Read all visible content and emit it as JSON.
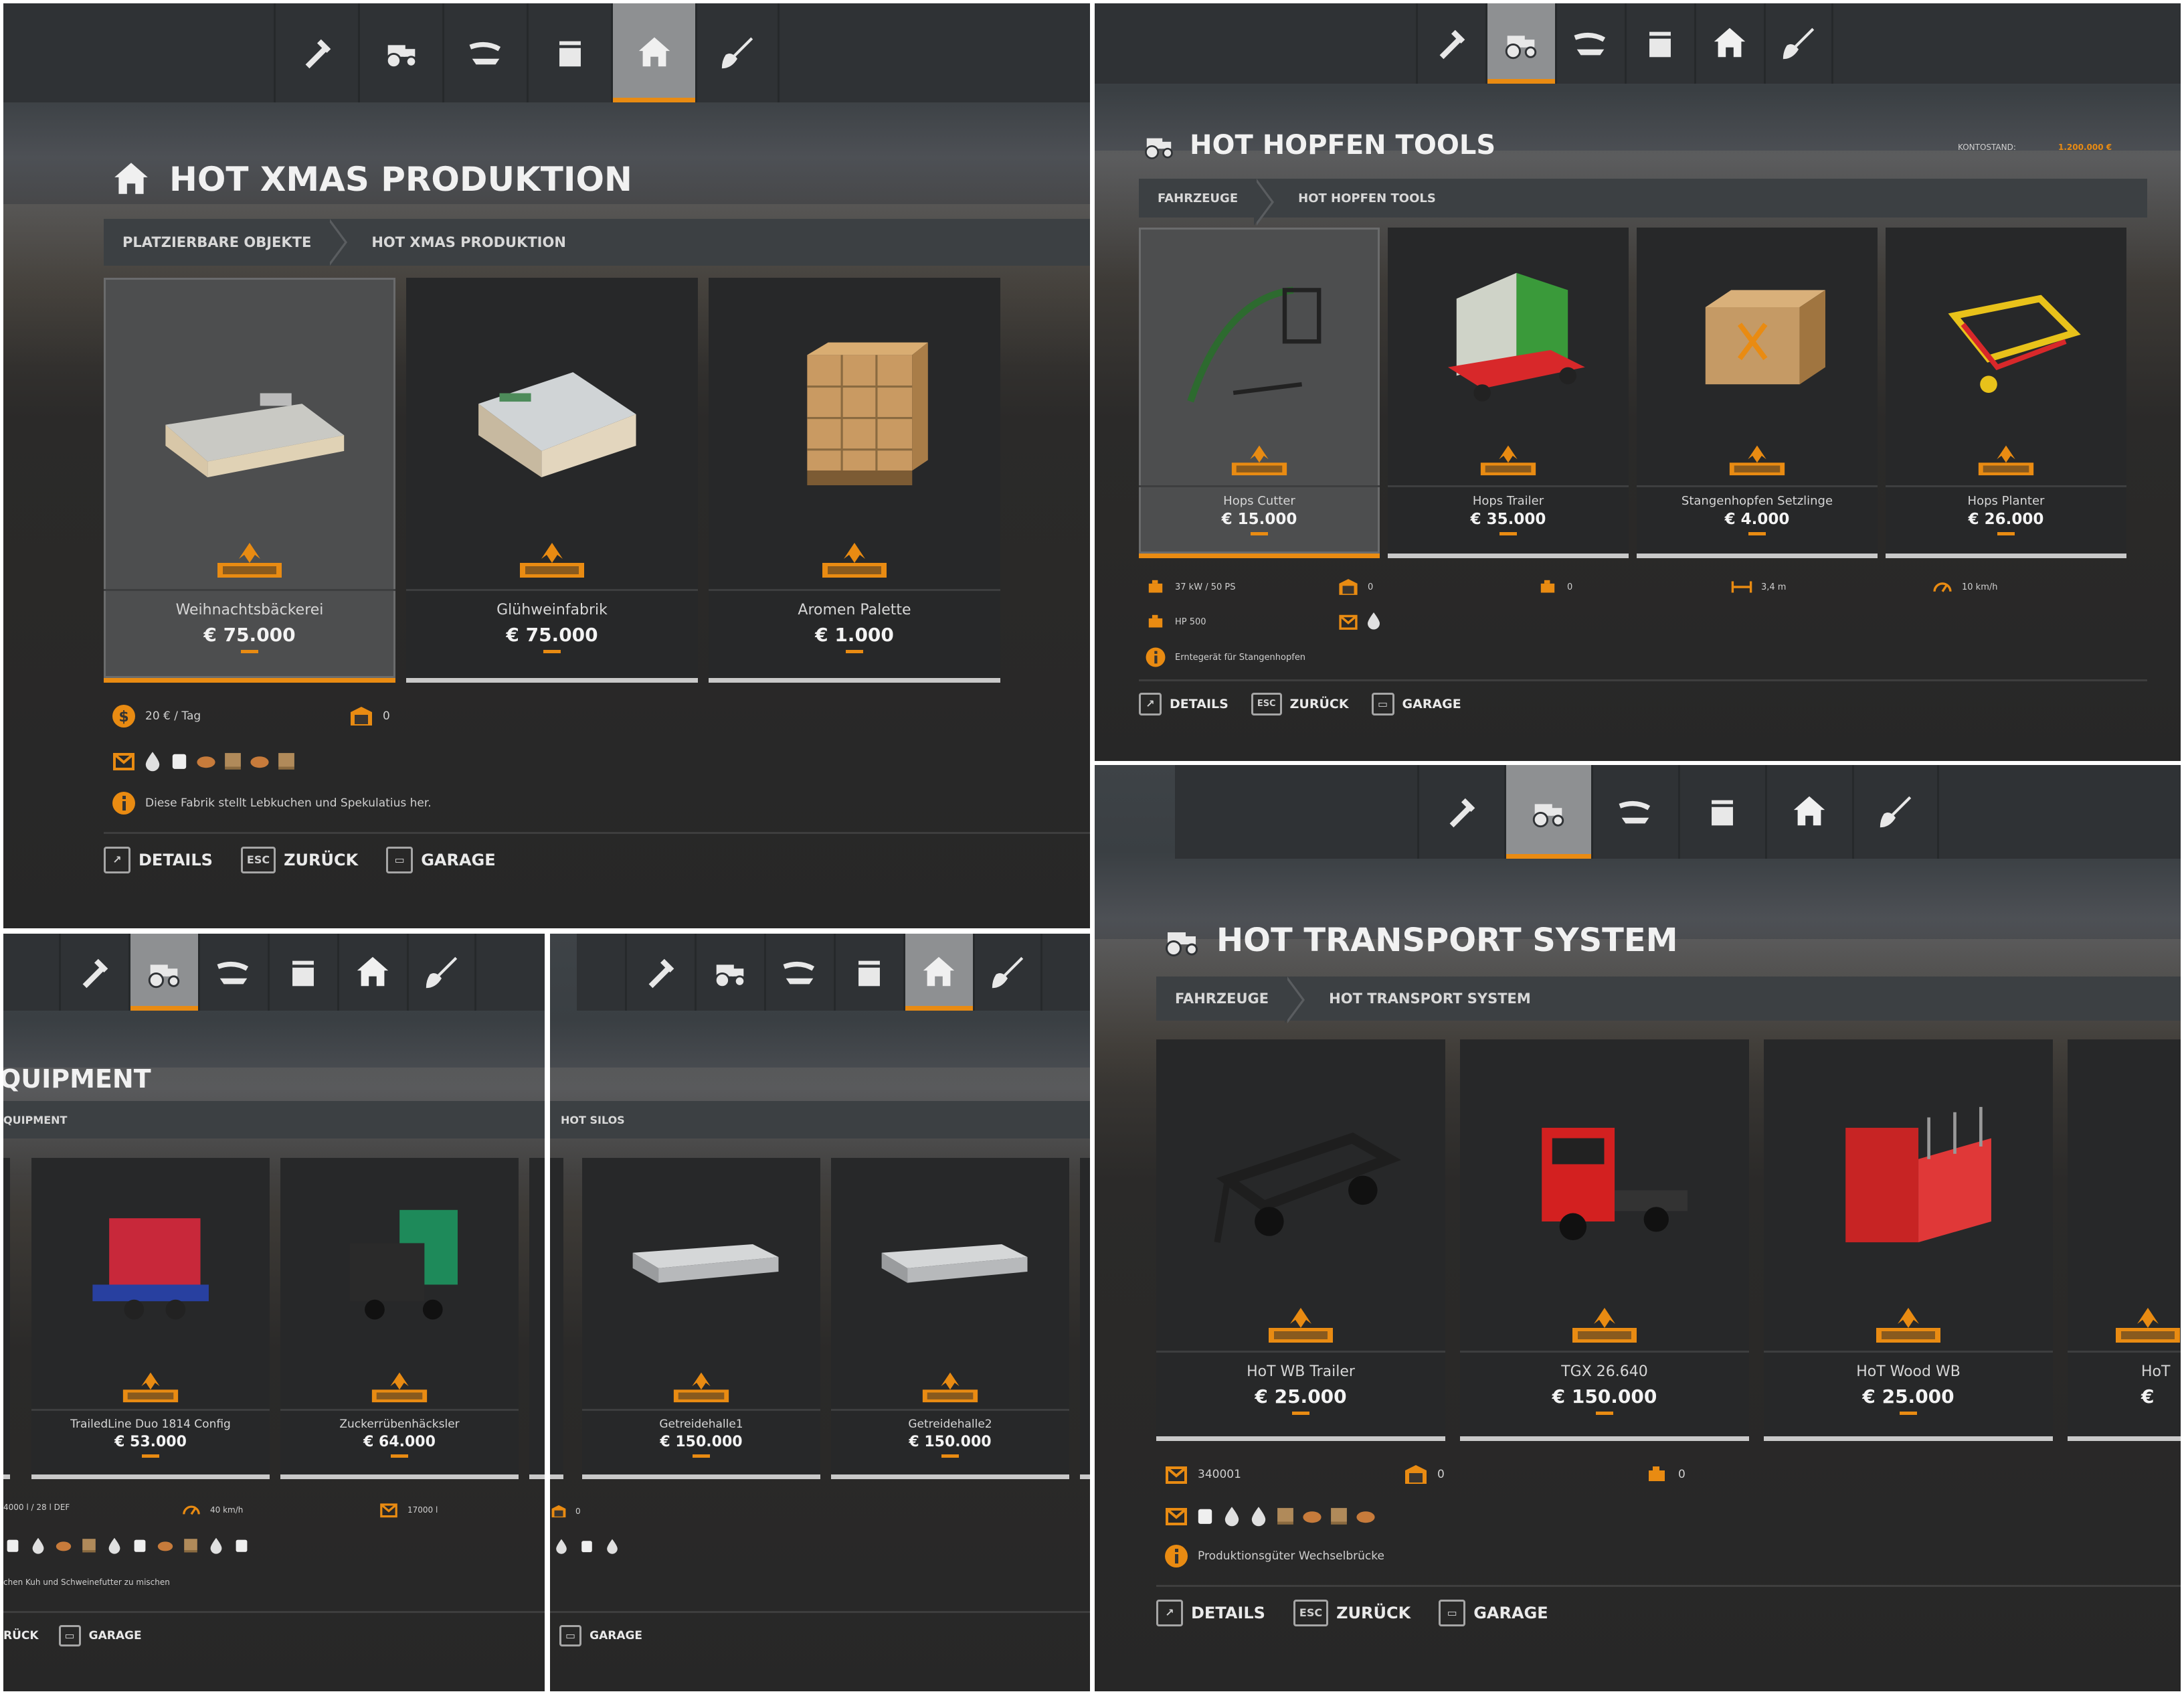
{
  "colors": {
    "accent": "#e98b12",
    "panel_bg": "#2b2a29",
    "tab_selected": "#8e9092"
  },
  "tabs": [
    "tools-icon",
    "tractor-icon",
    "hose-icon",
    "silo-icon",
    "house-icon",
    "shovel-icon"
  ],
  "panels": {
    "xmas": {
      "title": "HOT XMAS PRODUKTION",
      "title_icon": "house-icon",
      "breadcrumb": [
        "PLATZIERBARE OBJEKTE",
        "HOT XMAS PRODUKTION"
      ],
      "items": [
        {
          "name": "Weihnachtsbäckerei",
          "price": "€ 75.000"
        },
        {
          "name": "Glühweinfabrik",
          "price": "€ 75.000"
        },
        {
          "name": "Aromen Palette",
          "price": "€ 1.000"
        }
      ],
      "info": {
        "income": "20 € / Tag",
        "capacity": "0",
        "description": "Diese Fabrik stellt Lebkuchen und Spekulatius her."
      },
      "buttons": {
        "details": "DETAILS",
        "back": "ZURÜCK",
        "garage": "GARAGE",
        "key_esc": "ESC"
      }
    },
    "hopfen": {
      "title": "HOT HOPFEN TOOLS",
      "title_icon": "tractor-icon",
      "balance_label": "KONTOSTAND:",
      "balance": "1.200.000 €",
      "breadcrumb": [
        "FAHRZEUGE",
        "HOT HOPFEN TOOLS"
      ],
      "items": [
        {
          "name": "Hops Cutter",
          "price": "€ 15.000"
        },
        {
          "name": "Hops Trailer",
          "price": "€ 35.000"
        },
        {
          "name": "Stangenhopfen Setzlinge",
          "price": "€ 4.000"
        },
        {
          "name": "Hops Planter",
          "price": "€ 26.000"
        }
      ],
      "info": {
        "power": "37 kW / 50 PS",
        "capacity": "0",
        "hp": "HP 500",
        "gearbox": "0",
        "width": "3,4 m",
        "speed": "10 km/h",
        "description": "Erntegerät für Stangenhopfen"
      },
      "buttons": {
        "details": "DETAILS",
        "back": "ZURÜCK",
        "garage": "GARAGE",
        "key_esc": "ESC"
      }
    },
    "equipment": {
      "title": "QUIPMENT",
      "breadcrumb": [
        "QUIPMENT"
      ],
      "items": [
        {
          "name": "TrailedLine Duo 1814 Config",
          "price": "€ 53.000"
        },
        {
          "name": "Zuckerrübenhäcksler",
          "price": "€ 64.000"
        }
      ],
      "info": {
        "volume": "4000 l / 28 l DEF",
        "speed": "40 km/h",
        "capacity": "17000 l",
        "description": "chen Kuh und Schweinefutter zu mischen"
      },
      "buttons": {
        "back": "RÜCK",
        "garage": "GARAGE"
      }
    },
    "silos": {
      "breadcrumb": [
        "HOT SILOS"
      ],
      "items": [
        {
          "name": "Getreidehalle1",
          "price": "€ 150.000"
        },
        {
          "name": "Getreidehalle2",
          "price": "€ 150.000"
        }
      ],
      "info": {
        "capacity": "0"
      },
      "buttons": {
        "garage": "GARAGE"
      }
    },
    "transport": {
      "title": "HOT TRANSPORT SYSTEM",
      "title_icon": "tractor-icon",
      "breadcrumb": [
        "FAHRZEUGE",
        "HOT TRANSPORT SYSTEM"
      ],
      "items": [
        {
          "name": "HoT WB Trailer",
          "price": "€ 25.000"
        },
        {
          "name": "TGX 26.640",
          "price": "€ 150.000"
        },
        {
          "name": "HoT Wood WB",
          "price": "€ 25.000"
        },
        {
          "name": "HoT",
          "price": "€"
        }
      ],
      "info": {
        "capacity_l": "340001",
        "capacity": "0",
        "gear": "0",
        "description": "Produktionsgüter Wechselbrücke"
      },
      "buttons": {
        "details": "DETAILS",
        "back": "ZURÜCK",
        "garage": "GARAGE",
        "key_esc": "ESC"
      }
    }
  }
}
